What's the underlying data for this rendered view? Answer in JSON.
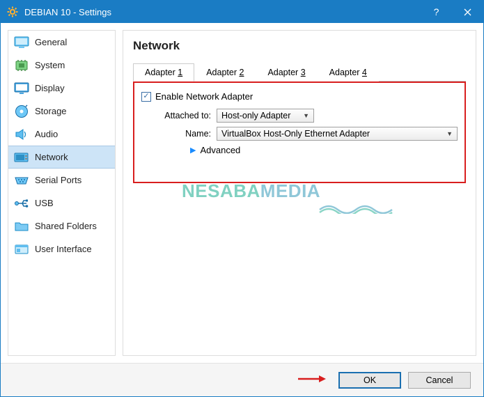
{
  "window": {
    "title": "DEBIAN 10 - Settings"
  },
  "sidebar": {
    "items": [
      {
        "label": "General"
      },
      {
        "label": "System"
      },
      {
        "label": "Display"
      },
      {
        "label": "Storage"
      },
      {
        "label": "Audio"
      },
      {
        "label": "Network"
      },
      {
        "label": "Serial Ports"
      },
      {
        "label": "USB"
      },
      {
        "label": "Shared Folders"
      },
      {
        "label": "User Interface"
      }
    ],
    "selected_index": 5
  },
  "main": {
    "title": "Network",
    "tabs": [
      {
        "label": "Adapter 1",
        "accesskey_index": 8
      },
      {
        "label": "Adapter 2",
        "accesskey_index": 8
      },
      {
        "label": "Adapter 3",
        "accesskey_index": 8
      },
      {
        "label": "Adapter 4",
        "accesskey_index": 8
      }
    ],
    "active_tab": 0,
    "enable_checkbox": {
      "checked": true,
      "label": "Enable Network Adapter"
    },
    "attached_to": {
      "label": "Attached to:",
      "value": "Host-only Adapter"
    },
    "name": {
      "label": "Name:",
      "value": "VirtualBox Host-Only Ethernet Adapter"
    },
    "advanced": {
      "label": "Advanced",
      "expanded": false
    }
  },
  "watermark": {
    "part1": "NESABA",
    "part2": "MEDIA"
  },
  "footer": {
    "ok": "OK",
    "cancel": "Cancel"
  }
}
